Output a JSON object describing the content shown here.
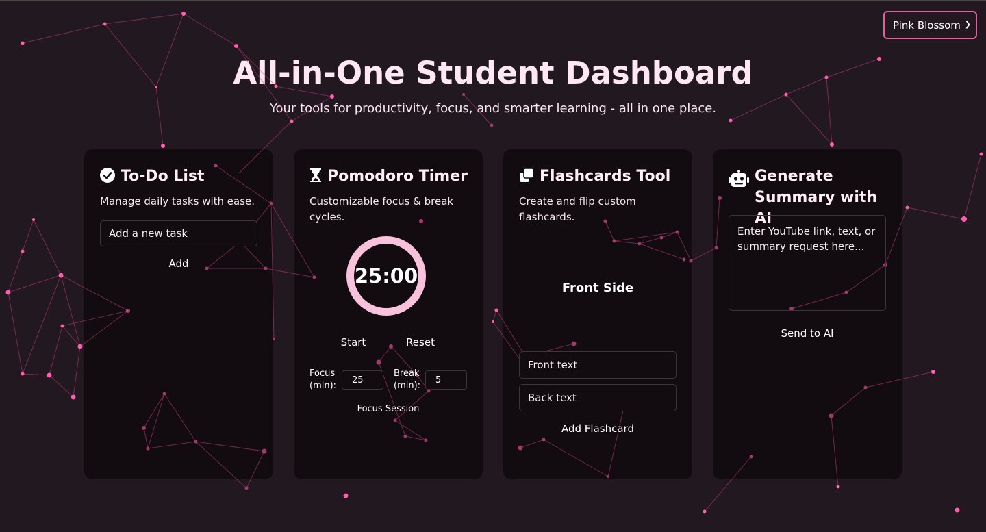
{
  "theme": {
    "selected": "Pink Blossom",
    "accent": "#ec5ba3",
    "background": "#211820",
    "card": "#120c10",
    "ring": "#f8c2dc"
  },
  "header": {
    "title": "All-in-One Student Dashboard",
    "subtitle": "Your tools for productivity, focus, and smarter learning - all in one place."
  },
  "todo": {
    "icon": "check-circle-icon",
    "title": "To-Do List",
    "description": "Manage daily tasks with ease.",
    "input_placeholder": "Add a new task",
    "add_label": "Add"
  },
  "pomodoro": {
    "icon": "hourglass-icon",
    "title": "Pomodoro Timer",
    "description": "Customizable focus & break cycles.",
    "time": "25:00",
    "start_label": "Start",
    "reset_label": "Reset",
    "focus_label": "Focus (min):",
    "focus_value": "25",
    "break_label": "Break (min):",
    "break_value": "5",
    "session_label": "Focus Session"
  },
  "flashcards": {
    "icon": "cards-icon",
    "title": "Flashcards Tool",
    "description": "Create and flip custom flashcards.",
    "card_text": "Front Side",
    "front_placeholder": "Front text",
    "back_placeholder": "Back text",
    "add_label": "Add Flashcard"
  },
  "ai": {
    "icon": "robot-icon",
    "title": "Generate Summary with AI",
    "input_placeholder": "Enter YouTube link, text, or summary request here...",
    "send_label": "Send to AI"
  }
}
